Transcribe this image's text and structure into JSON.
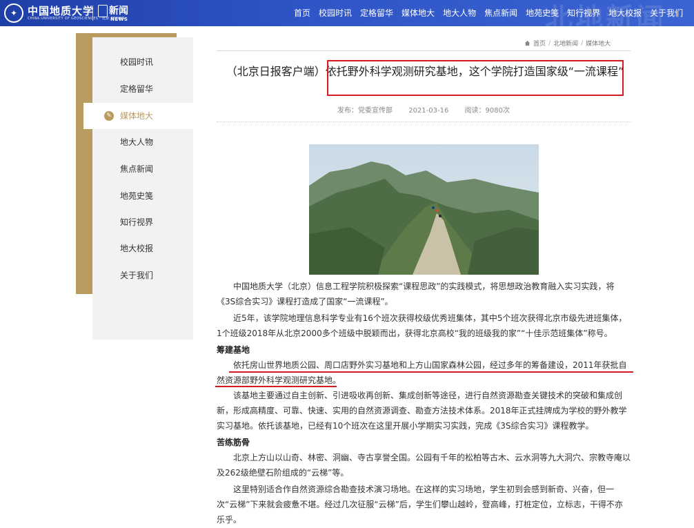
{
  "header": {
    "logo_cn": "中国地质大学",
    "logo_en": "CHINA UNIVERSITY OF GEOSCIENCES · 北京 BEIJING",
    "news_cn": "新闻",
    "news_en": "NEWS",
    "bg_text": "北地新闻",
    "nav": [
      "首页",
      "校园时讯",
      "定格留华",
      "媒体地大",
      "地大人物",
      "焦点新闻",
      "地苑史笺",
      "知行视界",
      "地大校报",
      "关于我们"
    ]
  },
  "sidebar": {
    "items": [
      {
        "label": "校园时讯"
      },
      {
        "label": "定格留华"
      },
      {
        "label": "媒体地大",
        "active": true
      },
      {
        "label": "地大人物"
      },
      {
        "label": "焦点新闻"
      },
      {
        "label": "地苑史笺"
      },
      {
        "label": "知行视界"
      },
      {
        "label": "地大校报"
      },
      {
        "label": "关于我们"
      }
    ]
  },
  "breadcrumb": [
    "首页",
    "北地新闻",
    "媒体地大"
  ],
  "article": {
    "title": "（北京日报客户端）依托野外科学观测研究基地，这个学院打造国家级“一流课程”",
    "meta": {
      "publisher": "发布：党委宣传部",
      "date": "2021-03-16",
      "reads": "阅读：9080次"
    },
    "p1": "中国地质大学（北京）信息工程学院积极探索“课程思政”的实践模式，将思想政治教育融入实习实践，将《3S综合实习》课程打造成了国家“一流课程”。",
    "p2": "近5年，该学院地理信息科学专业有16个班次获得校级优秀班集体，其中5个班次获得北京市级先进班集体，1个班级2018年从北京2000多个班级中脱颖而出，获得北京高校“我的班级我的家”“十佳示范班集体”称号。",
    "h1": "筹建基地",
    "p3": "依托房山世界地质公园、周口店野外实习基地和上方山国家森林公园，经过多年的筹备建设，2011年获批自然资源部野外科学观测研究基地。",
    "p4": "该基地主要通过自主创新、引进吸收再创新、集成创新等途径，进行自然资源勘查关键技术的突破和集成创新，形成高精度、可靠、快速、实用的自然资源调查、勘查方法技术体系。2018年正式挂牌成为学校的野外教学实习基地。依托该基地，已经有10个班次在这里开展小学期实习实践，完成《3S综合实习》课程教学。",
    "h2": "苦练筋骨",
    "p5": "北京上方山以山奇、林密、洞幽、寺古享誉全国。公园有千年的松柏等古木、云水洞等九大洞穴、宗教寺庵以及262级绝壁石阶组成的“云梯”等。",
    "p6": "这里特别适合作自然资源综合勘查技术演习场地。在这样的实习场地，学生初到会感到新奇、兴奋，但一次“云梯”下来就会疲惫不堪。经过几次征服“云梯”后，学生们攀山越岭，登高峰，打桩定位，立标志，干得不亦乐乎。"
  },
  "colors": {
    "header_blue": "#2f55c6",
    "gold": "#b99a5f",
    "highlight_red": "#d71920"
  }
}
